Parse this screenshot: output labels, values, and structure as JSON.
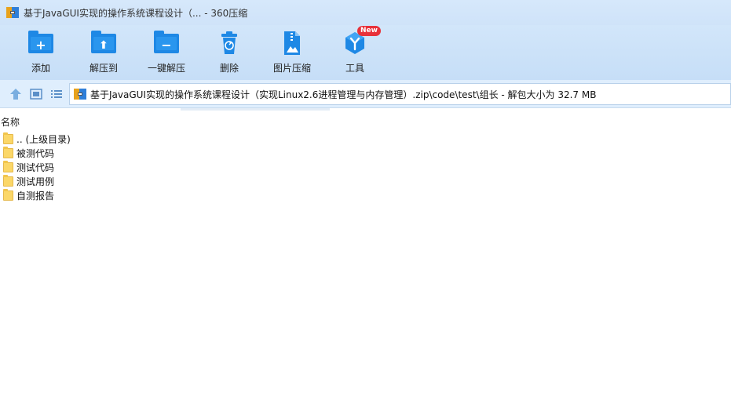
{
  "window": {
    "title": "基于JavaGUI实现的操作系统课程设计（... - 360压缩"
  },
  "toolbar": {
    "add_label": "添加",
    "extract_to_label": "解压到",
    "one_click_extract_label": "一键解压",
    "delete_label": "删除",
    "image_compress_label": "图片压缩",
    "tools_label": "工具",
    "tools_badge": "New"
  },
  "navbar": {
    "address": "基于JavaGUI实现的操作系统课程设计（实现Linux2.6进程管理与内存管理）.zip\\code\\test\\组长 - 解包大小为 32.7 MB"
  },
  "list": {
    "column_name": "名称",
    "items": [
      {
        "name": ".. (上级目录)"
      },
      {
        "name": "被测代码"
      },
      {
        "name": "测试代码"
      },
      {
        "name": "测试用例"
      },
      {
        "name": "自测报告"
      }
    ]
  },
  "colors": {
    "accent": "#1e88e5",
    "toolbar_bg": "#cfe3f9",
    "badge": "#e8313a",
    "folder": "#fbd768"
  },
  "icons": [
    "app-icon",
    "add-icon",
    "extract-to-icon",
    "one-click-extract-icon",
    "delete-icon",
    "image-compress-icon",
    "tools-icon",
    "up-arrow-icon",
    "thumbnail-view-icon",
    "list-view-icon",
    "folder-icon"
  ]
}
